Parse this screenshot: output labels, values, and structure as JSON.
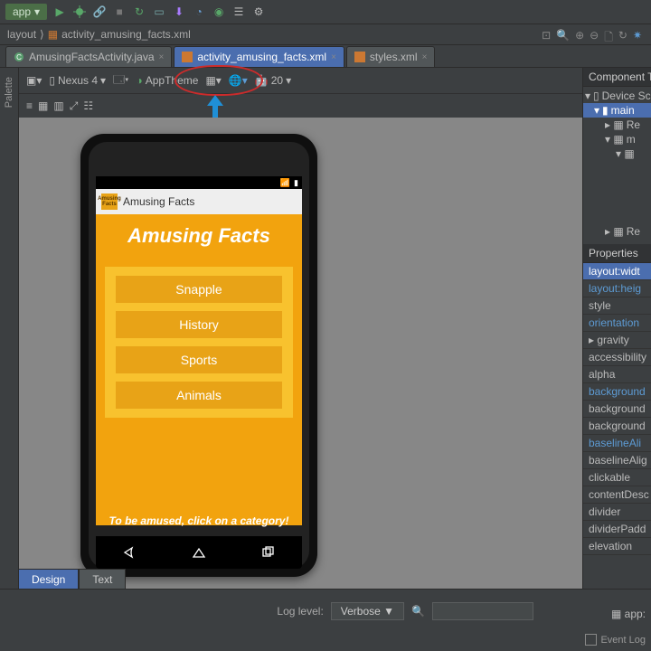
{
  "toolbar": {
    "app_label": "app"
  },
  "breadcrumb": {
    "item1": "layout",
    "item2": "activity_amusing_facts.xml"
  },
  "tabs": [
    {
      "label": "AmusingFactsActivity.java"
    },
    {
      "label": "activity_amusing_facts.xml"
    },
    {
      "label": "styles.xml"
    }
  ],
  "palette_label": "Palette",
  "design_toolbar": {
    "device": "Nexus 4",
    "theme": "AppTheme",
    "api": "20"
  },
  "phone": {
    "actionbar_title": "Amusing Facts",
    "logo_text": "Amusing Facts",
    "hero": "Amusing Facts",
    "categories": [
      "Snapple",
      "History",
      "Sports",
      "Animals"
    ],
    "footer": "To be amused, click on a category!"
  },
  "component_tree": {
    "title": "Component Tree",
    "device": "Device Sc",
    "main": "main",
    "r1": "Re",
    "m": "m",
    "r2": "Re"
  },
  "properties": {
    "title": "Properties",
    "rows": [
      {
        "label": "layout:widt",
        "hl": true
      },
      {
        "label": "layout:heig",
        "blue": true
      },
      {
        "label": "style"
      },
      {
        "label": "orientation",
        "blue": true
      },
      {
        "label": "gravity",
        "arrow": true
      },
      {
        "label": "accessibility"
      },
      {
        "label": "alpha"
      },
      {
        "label": "background",
        "blue": true
      },
      {
        "label": "background"
      },
      {
        "label": "background"
      },
      {
        "label": "baselineAli",
        "blue": true
      },
      {
        "label": "baselineAlig"
      },
      {
        "label": "clickable"
      },
      {
        "label": "contentDesc"
      },
      {
        "label": "divider"
      },
      {
        "label": "dividerPadd"
      },
      {
        "label": "elevation"
      }
    ]
  },
  "design_tabs": {
    "design": "Design",
    "text": "Text"
  },
  "bottom": {
    "loglabel": "Log level:",
    "logvalue": "Verbose",
    "appbadge": "app:",
    "eventlog": "Event Log"
  }
}
